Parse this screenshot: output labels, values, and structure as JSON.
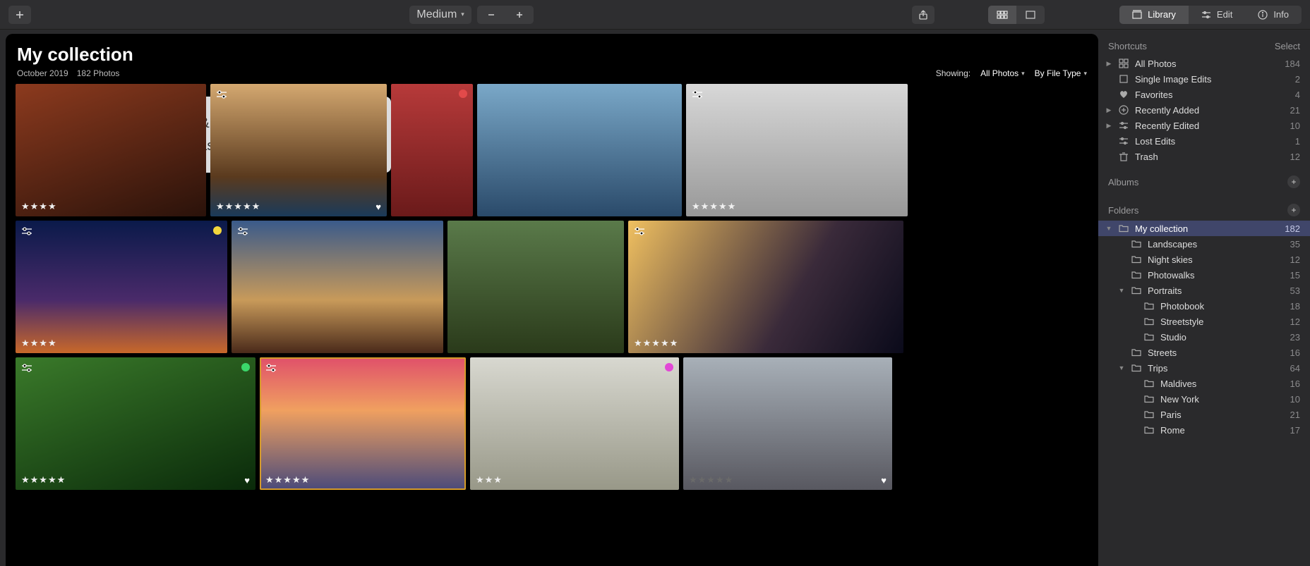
{
  "toolbar": {
    "zoom_label": "Medium",
    "tabs": {
      "library": "Library",
      "edit": "Edit",
      "info": "Info"
    }
  },
  "collection": {
    "title": "My collection",
    "date": "October 2019",
    "count_label": "182 Photos",
    "showing_label": "Showing:",
    "showing_value": "All Photos",
    "sort_value": "By File Type"
  },
  "overlay_text": "Explore, rate, sort & enjoy images from all your folders with ease and pleasure.",
  "thumbs": {
    "r1": [
      {
        "stars": "★★★★"
      },
      {
        "stars": "★★★★★",
        "heart": true,
        "sliders": true
      },
      {
        "dot": "red"
      },
      {},
      {
        "stars": "★★★★★",
        "sliders": true
      }
    ],
    "r2": [
      {
        "stars": "★★★★",
        "dot": "yellow",
        "sliders": true
      },
      {
        "sliders": true
      },
      {},
      {
        "stars": "★★★★★",
        "sliders": true
      }
    ],
    "r3": [
      {
        "stars": "★★★★★",
        "heart": true,
        "dot": "green",
        "sliders": true
      },
      {
        "stars": "★★★★★",
        "selected": true,
        "sliders": true
      },
      {
        "stars": "★★★",
        "dot": "magenta"
      },
      {
        "stars": "★★★★★",
        "heart": true,
        "dim": true
      }
    ]
  },
  "sidebar": {
    "shortcuts_title": "Shortcuts",
    "select_label": "Select",
    "albums_title": "Albums",
    "folders_title": "Folders",
    "shortcuts": [
      {
        "icon": "grid",
        "label": "All Photos",
        "count": "184",
        "disclosure": true
      },
      {
        "icon": "single",
        "label": "Single Image Edits",
        "count": "2"
      },
      {
        "icon": "heart",
        "label": "Favorites",
        "count": "4"
      },
      {
        "icon": "plus-circle",
        "label": "Recently Added",
        "count": "21",
        "disclosure": true
      },
      {
        "icon": "sliders",
        "label": "Recently Edited",
        "count": "10",
        "disclosure": true
      },
      {
        "icon": "sliders",
        "label": "Lost Edits",
        "count": "1"
      },
      {
        "icon": "trash",
        "label": "Trash",
        "count": "12"
      }
    ],
    "folders": [
      {
        "indent": 0,
        "label": "My collection",
        "count": "182",
        "selected": true,
        "open": true
      },
      {
        "indent": 1,
        "label": "Landscapes",
        "count": "35"
      },
      {
        "indent": 1,
        "label": "Night skies",
        "count": "12"
      },
      {
        "indent": 1,
        "label": "Photowalks",
        "count": "15"
      },
      {
        "indent": 1,
        "label": "Portraits",
        "count": "53",
        "open": true
      },
      {
        "indent": 2,
        "label": "Photobook",
        "count": "18"
      },
      {
        "indent": 2,
        "label": "Streetstyle",
        "count": "12"
      },
      {
        "indent": 2,
        "label": "Studio",
        "count": "23"
      },
      {
        "indent": 1,
        "label": "Streets",
        "count": "16"
      },
      {
        "indent": 1,
        "label": "Trips",
        "count": "64",
        "open": true
      },
      {
        "indent": 2,
        "label": "Maldives",
        "count": "16"
      },
      {
        "indent": 2,
        "label": "New York",
        "count": "10"
      },
      {
        "indent": 2,
        "label": "Paris",
        "count": "21"
      },
      {
        "indent": 2,
        "label": "Rome",
        "count": "17"
      }
    ]
  }
}
